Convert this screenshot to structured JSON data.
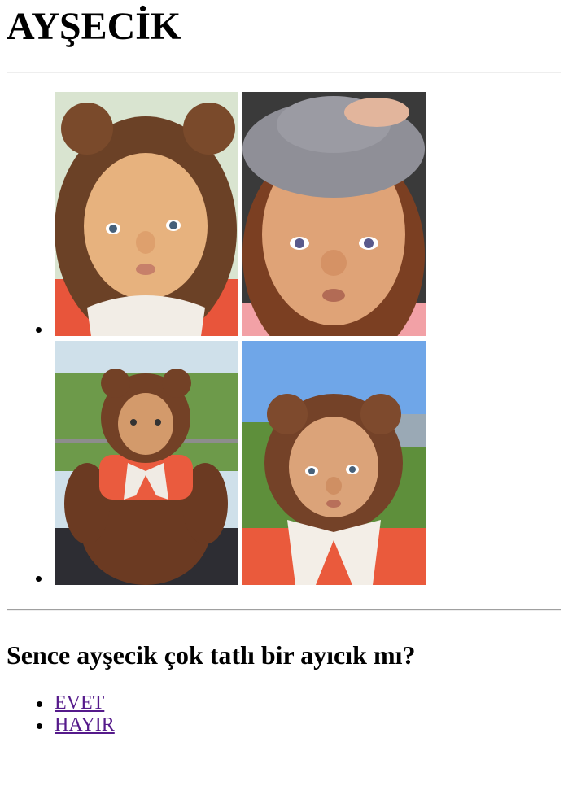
{
  "page": {
    "title": "AYŞECİK",
    "question": "Sence ayşecik çok tatlı bir ayıcık mı?",
    "answers": [
      {
        "label": "EVET"
      },
      {
        "label": "HAYIR"
      }
    ],
    "link_color": "#551a8b"
  },
  "gallery": {
    "rows": [
      {
        "photos": [
          "bear-hood-doll-face-closeup",
          "knit-hat-doll-face-closeup"
        ]
      },
      {
        "photos": [
          "teddy-bear-doll-sitting-full",
          "bear-hood-doll-outdoor-sky"
        ]
      }
    ]
  }
}
